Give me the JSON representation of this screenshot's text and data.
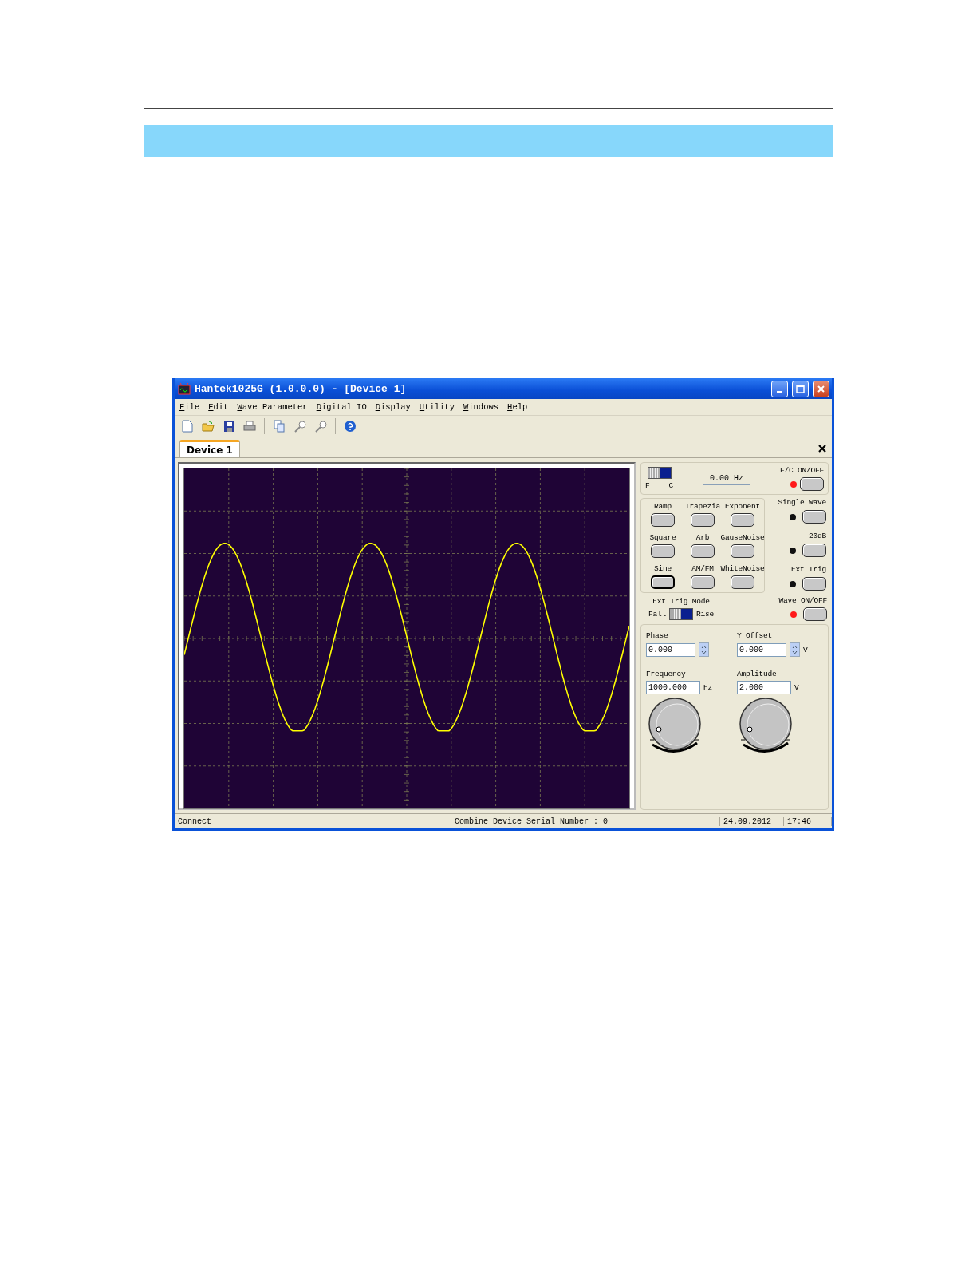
{
  "window": {
    "title": "Hantek1025G (1.0.0.0) - [Device 1]"
  },
  "menu": [
    "File",
    "Edit",
    "Wave Parameter",
    "Digital IO",
    "Display",
    "Utility",
    "Windows",
    "Help"
  ],
  "tabs": [
    {
      "label": "Device 1",
      "selected": true
    }
  ],
  "fc_panel": {
    "switch_labels": [
      "F",
      "C"
    ],
    "switch_on": true,
    "reading": "0.00 Hz",
    "button_label": "F/C ON/OFF",
    "led_on": true
  },
  "wave_types": [
    {
      "label": "Ramp",
      "selected": false
    },
    {
      "label": "Trapezia",
      "selected": false
    },
    {
      "label": "Exponent",
      "selected": false
    },
    {
      "label": "Square",
      "selected": false
    },
    {
      "label": "Arb",
      "selected": false
    },
    {
      "label": "GauseNoise",
      "selected": false
    },
    {
      "label": "Sine",
      "selected": true
    },
    {
      "label": "AM/FM",
      "selected": false
    },
    {
      "label": "WhiteNoise",
      "selected": false
    }
  ],
  "side_controls": [
    {
      "label": "Single Wave",
      "led_on": false
    },
    {
      "label": "-20dB",
      "led_on": false
    },
    {
      "label": "Ext Trig",
      "led_on": false
    }
  ],
  "ext_trig_mode": {
    "label": "Ext Trig Mode",
    "left": "Fall",
    "right": "Rise",
    "on": true
  },
  "wave_output": {
    "label": "Wave ON/OFF",
    "led_on": true
  },
  "parameters": [
    {
      "label": "Phase",
      "value": "0.000",
      "kind": "spin"
    },
    {
      "label": "Y Offset",
      "value": "0.000",
      "kind": "spin",
      "unit": "V"
    },
    {
      "label": "Frequency",
      "value": "1000.000",
      "kind": "knob",
      "unit": "Hz"
    },
    {
      "label": "Amplitude",
      "value": "2.000",
      "kind": "knob",
      "unit": "V"
    }
  ],
  "status_bar": [
    "Connect",
    "Combine Device Serial Number : 0",
    "24.09.2012",
    "17:46"
  ]
}
